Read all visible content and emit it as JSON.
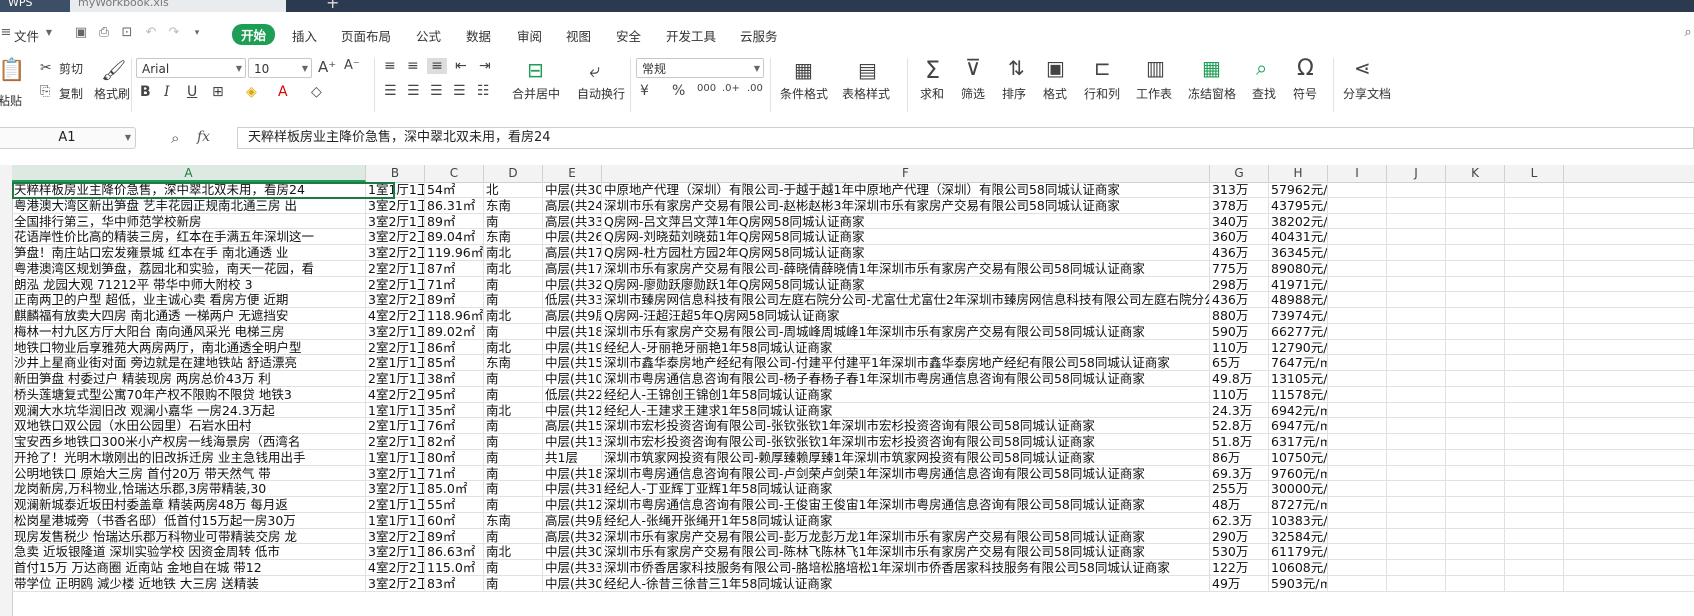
{
  "tabs": {
    "app": "WPS",
    "workbook": "myWorkbook.xls",
    "add": "+"
  },
  "menu": {
    "file": "文件",
    "items": [
      "开始",
      "插入",
      "页面布局",
      "公式",
      "数据",
      "审阅",
      "视图",
      "安全",
      "开发工具",
      "云服务"
    ]
  },
  "ribbon": {
    "paste": "粘贴",
    "cut": "剪切",
    "copy": "复制",
    "format_painter": "格式刷",
    "font": "Arial",
    "font_size": "10",
    "merge_center": "合并居中",
    "wrap": "自动换行",
    "number_format": "常规",
    "cond_format": "条件格式",
    "table_style": "表格样式",
    "sum": "求和",
    "filter": "筛选",
    "sort": "排序",
    "format": "格式",
    "row_col": "行和列",
    "worksheet": "工作表",
    "freeze": "冻结窗格",
    "find": "查找",
    "symbol": "符号",
    "share": "分享文档"
  },
  "formula_bar": {
    "cell_ref": "A1",
    "fx": "fx",
    "content": "天粹样板房业主降价急售，深中翠北双未用，看房24"
  },
  "columns": [
    "A",
    "B",
    "C",
    "D",
    "E",
    "F",
    "G",
    "H",
    "I",
    "J",
    "K",
    "L"
  ],
  "rows": [
    [
      "天粹样板房业主降价急售，深中翠北双未用，看房24",
      "1室1厅1卫",
      "54㎡",
      "北",
      "中层(共30",
      "中原地产代理（深圳）有限公司-于越于越1年中原地产代理（深圳）有限公司58同城认证商家",
      "313万",
      "57962元/㎡"
    ],
    [
      "粤港澳大湾区新出笋盘 艺丰花园正规南北通三房 出",
      "3室2厅1卫",
      "86.31㎡",
      "东南",
      "高层(共24",
      "深圳市乐有家房产交易有限公司-赵彬赵彬3年深圳市乐有家房产交易有限公司58同城认证商家",
      "378万",
      "43795元/㎡"
    ],
    [
      "全国排行第三，华中师范学校新房",
      "3室2厅1卫",
      "89㎡",
      "南",
      "高层(共33",
      "Q房网-吕文萍吕文萍1年Q房网58同城认证商家",
      "340万",
      "38202元/㎡"
    ],
    [
      "花语岸性价比高的精装三房，红本在手满五年深圳这一",
      "3室2厅2卫",
      "89.04㎡",
      "东南",
      "中层(共26",
      "Q房网-刘晓茹刘晓茹1年Q房网58同城认证商家",
      "360万",
      "40431元/㎡"
    ],
    [
      "笋盘！南庄站口宏发雍景城 红本在手 南北通透 业",
      "3室2厅2卫",
      "119.96㎡",
      "南北",
      "高层(共17",
      "Q房网-杜方园杜方园2年Q房网58同城认证商家",
      "436万",
      "36345元/㎡"
    ],
    [
      "粤港澳湾区规划笋盘，荔园北和实验，南天一花园，看",
      "2室2厅1卫",
      "87㎡",
      "南北",
      "高层(共17",
      "深圳市乐有家房产交易有限公司-薛晓倩薛晓倩1年深圳市乐有家房产交易有限公司58同城认证商家",
      "775万",
      "89080元/㎡"
    ],
    [
      "朗泓 龙园大观 71212平 带华中师大附校 3",
      "2室2厅1卫",
      "71㎡",
      "南",
      "中层(共32",
      "Q房网-廖勋跃廖勋跃1年Q房网58同城认证商家",
      "298万",
      "41971元/㎡"
    ],
    [
      "正南两卫的户型 超低，业主诚心卖 看房方便 近期",
      "3室2厅2卫",
      "89㎡",
      "南",
      "低层(共33",
      "深圳市臻房网信息科技有限公司左庭右院分公司-尤富仕尤富仕2年深圳市臻房网信息科技有限公司左庭右院分公司58",
      "436万",
      "48988元/㎡"
    ],
    [
      "麒麟福有放卖大四房 南北通透 一梯两户 无遮挡安",
      "4室2厅2卫",
      "118.96㎡",
      "南北",
      "高层(共9层",
      "Q房网-汪超汪超5年Q房网58同城认证商家",
      "880万",
      "73974元/㎡"
    ],
    [
      "梅林一村九区方厅大阳台 南向通风采光 电梯三房",
      "3室2厅1卫",
      "89.02㎡",
      "南",
      "中层(共18",
      "深圳市乐有家房产交易有限公司-周城峰周城峰1年深圳市乐有家房产交易有限公司58同城认证商家",
      "590万",
      "66277元/㎡"
    ],
    [
      "地铁口物业后享雅苑大两房两厅，南北通透全明户型",
      "2室2厅1卫",
      "86㎡",
      "南北",
      "中层(共19",
      "经纪人-牙丽艳牙丽艳1年58同城认证商家",
      "110万",
      "12790元/㎡"
    ],
    [
      "沙井上星商业街对面 旁边就是在建地铁站 舒适漂亮",
      "2室1厅1卫",
      "85㎡",
      "东南",
      "中层(共15",
      "深圳市鑫华泰房地产经纪有限公司-付建平付建平1年深圳市鑫华泰房地产经纪有限公司58同城认证商家",
      "65万",
      "7647元/㎡"
    ],
    [
      "新田笋盘 村委过户 精装现房 两房总价43万 利",
      "2室1厅1卫",
      "38㎡",
      "南",
      "中层(共10",
      "深圳市粤房通信息咨询有限公司-杨子春杨子春1年深圳市粤房通信息咨询有限公司58同城认证商家",
      "49.8万",
      "13105元/㎡"
    ],
    [
      "桥头莲塘复式型公寓70年产权不限购不限贷 地铁3",
      "4室2厅2卫",
      "95㎡",
      "南",
      "低层(共22",
      "经纪人-王锦创王锦创1年58同城认证商家",
      "110万",
      "11578元/㎡"
    ],
    [
      "观澜大水坑华润旧改 观澜小嘉华 一房24.3万起",
      "1室1厅1卫",
      "35㎡",
      "南北",
      "中层(共12",
      "经纪人-王建求王建求1年58同城认证商家",
      "24.3万",
      "6942元/㎡"
    ],
    [
      "双地铁口双公园（水田公园里）石岩水田村",
      "2室1厅1卫",
      "76㎡",
      "南",
      "高层(共15",
      "深圳市宏杉投资咨询有限公司-张钦张钦1年深圳市宏杉投资咨询有限公司58同城认证商家",
      "52.8万",
      "6947元/㎡"
    ],
    [
      "宝安西乡地铁口300米小产权房一线海景房（西湾名",
      "2室2厅1卫",
      "82㎡",
      "南",
      "中层(共13",
      "深圳市宏杉投资咨询有限公司-张钦张钦1年深圳市宏杉投资咨询有限公司58同城认证商家",
      "51.8万",
      "6317元/㎡"
    ],
    [
      "开抢了！光明木墩刚出的旧改拆迁房 业主急钱用出手",
      "1室1厅1卫",
      "80㎡",
      "南",
      "共1层",
      "深圳市筑家网投资有限公司-赖厚臻赖厚臻1年深圳市筑家网投资有限公司58同城认证商家",
      "86万",
      "10750元/㎡"
    ],
    [
      "公明地铁口 原始大三房 首付20万 带天然气 带",
      "3室2厅1卫",
      "71㎡",
      "南",
      "中层(共18",
      "深圳市粤房通信息咨询有限公司-卢剑荣卢剑荣1年深圳市粤房通信息咨询有限公司58同城认证商家",
      "69.3万",
      "9760元/㎡"
    ],
    [
      "龙岗新房,万科物业,恰瑞达乐郡,3房带精装,30",
      "3室2厅1卫",
      "85.0㎡",
      "南",
      "中层(共31",
      "经纪人-丁亚辉丁亚辉1年58同城认证商家",
      "255万",
      "30000元/㎡"
    ],
    [
      "观澜新城泰近坂田村委盖章 精装两房48万 每月返",
      "2室1厅1卫",
      "55㎡",
      "南",
      "中层(共12",
      "深圳市粤房通信息咨询有限公司-王俊宙王俊宙1年深圳市粤房通信息咨询有限公司58同城认证商家",
      "48万",
      "8727元/㎡"
    ],
    [
      "松岗星港城旁（书香名邸）低首付15万起一房30万",
      "1室1厅1卫",
      "60㎡",
      "东南",
      "高层(共9层",
      "经纪人-张绳开张绳开1年58同城认证商家",
      "62.3万",
      "10383元/㎡"
    ],
    [
      "现房发售税少 怡瑞达乐郡万科物业可带精装交房 龙",
      "3室2厅2卫",
      "89㎡",
      "南",
      "高层(共32",
      "深圳市乐有家房产交易有限公司-彭万龙彭万龙1年深圳市乐有家房产交易有限公司58同城认证商家",
      "290万",
      "32584元/㎡"
    ],
    [
      "急卖 近坂银隆道 深圳实验学校 因资金周转 低市",
      "3室2厅1卫",
      "86.63㎡",
      "南北",
      "中层(共30",
      "深圳市乐有家房产交易有限公司-陈林飞陈林飞1年深圳市乐有家房产交易有限公司58同城认证商家",
      "530万",
      "61179元/㎡"
    ],
    [
      "首付15万 万达商圈 近南站 金地自在城 带12",
      "4室2厅2卫",
      "115.0㎡",
      "南",
      "中层(共33",
      "深圳市侨香居家科技服务有限公司-胳培松胳培松1年深圳市侨香居家科技服务有限公司58同城认证商家",
      "122万",
      "10608元/㎡"
    ],
    [
      "带学位 正明鸥 減少楼 近地铁 大三房 送精装",
      "3室2厅2卫",
      "83㎡",
      "南",
      "中层(共30",
      "经纪人-徐昔三徐昔三1年58同城认证商家",
      "49万",
      "5903元/㎡"
    ]
  ]
}
